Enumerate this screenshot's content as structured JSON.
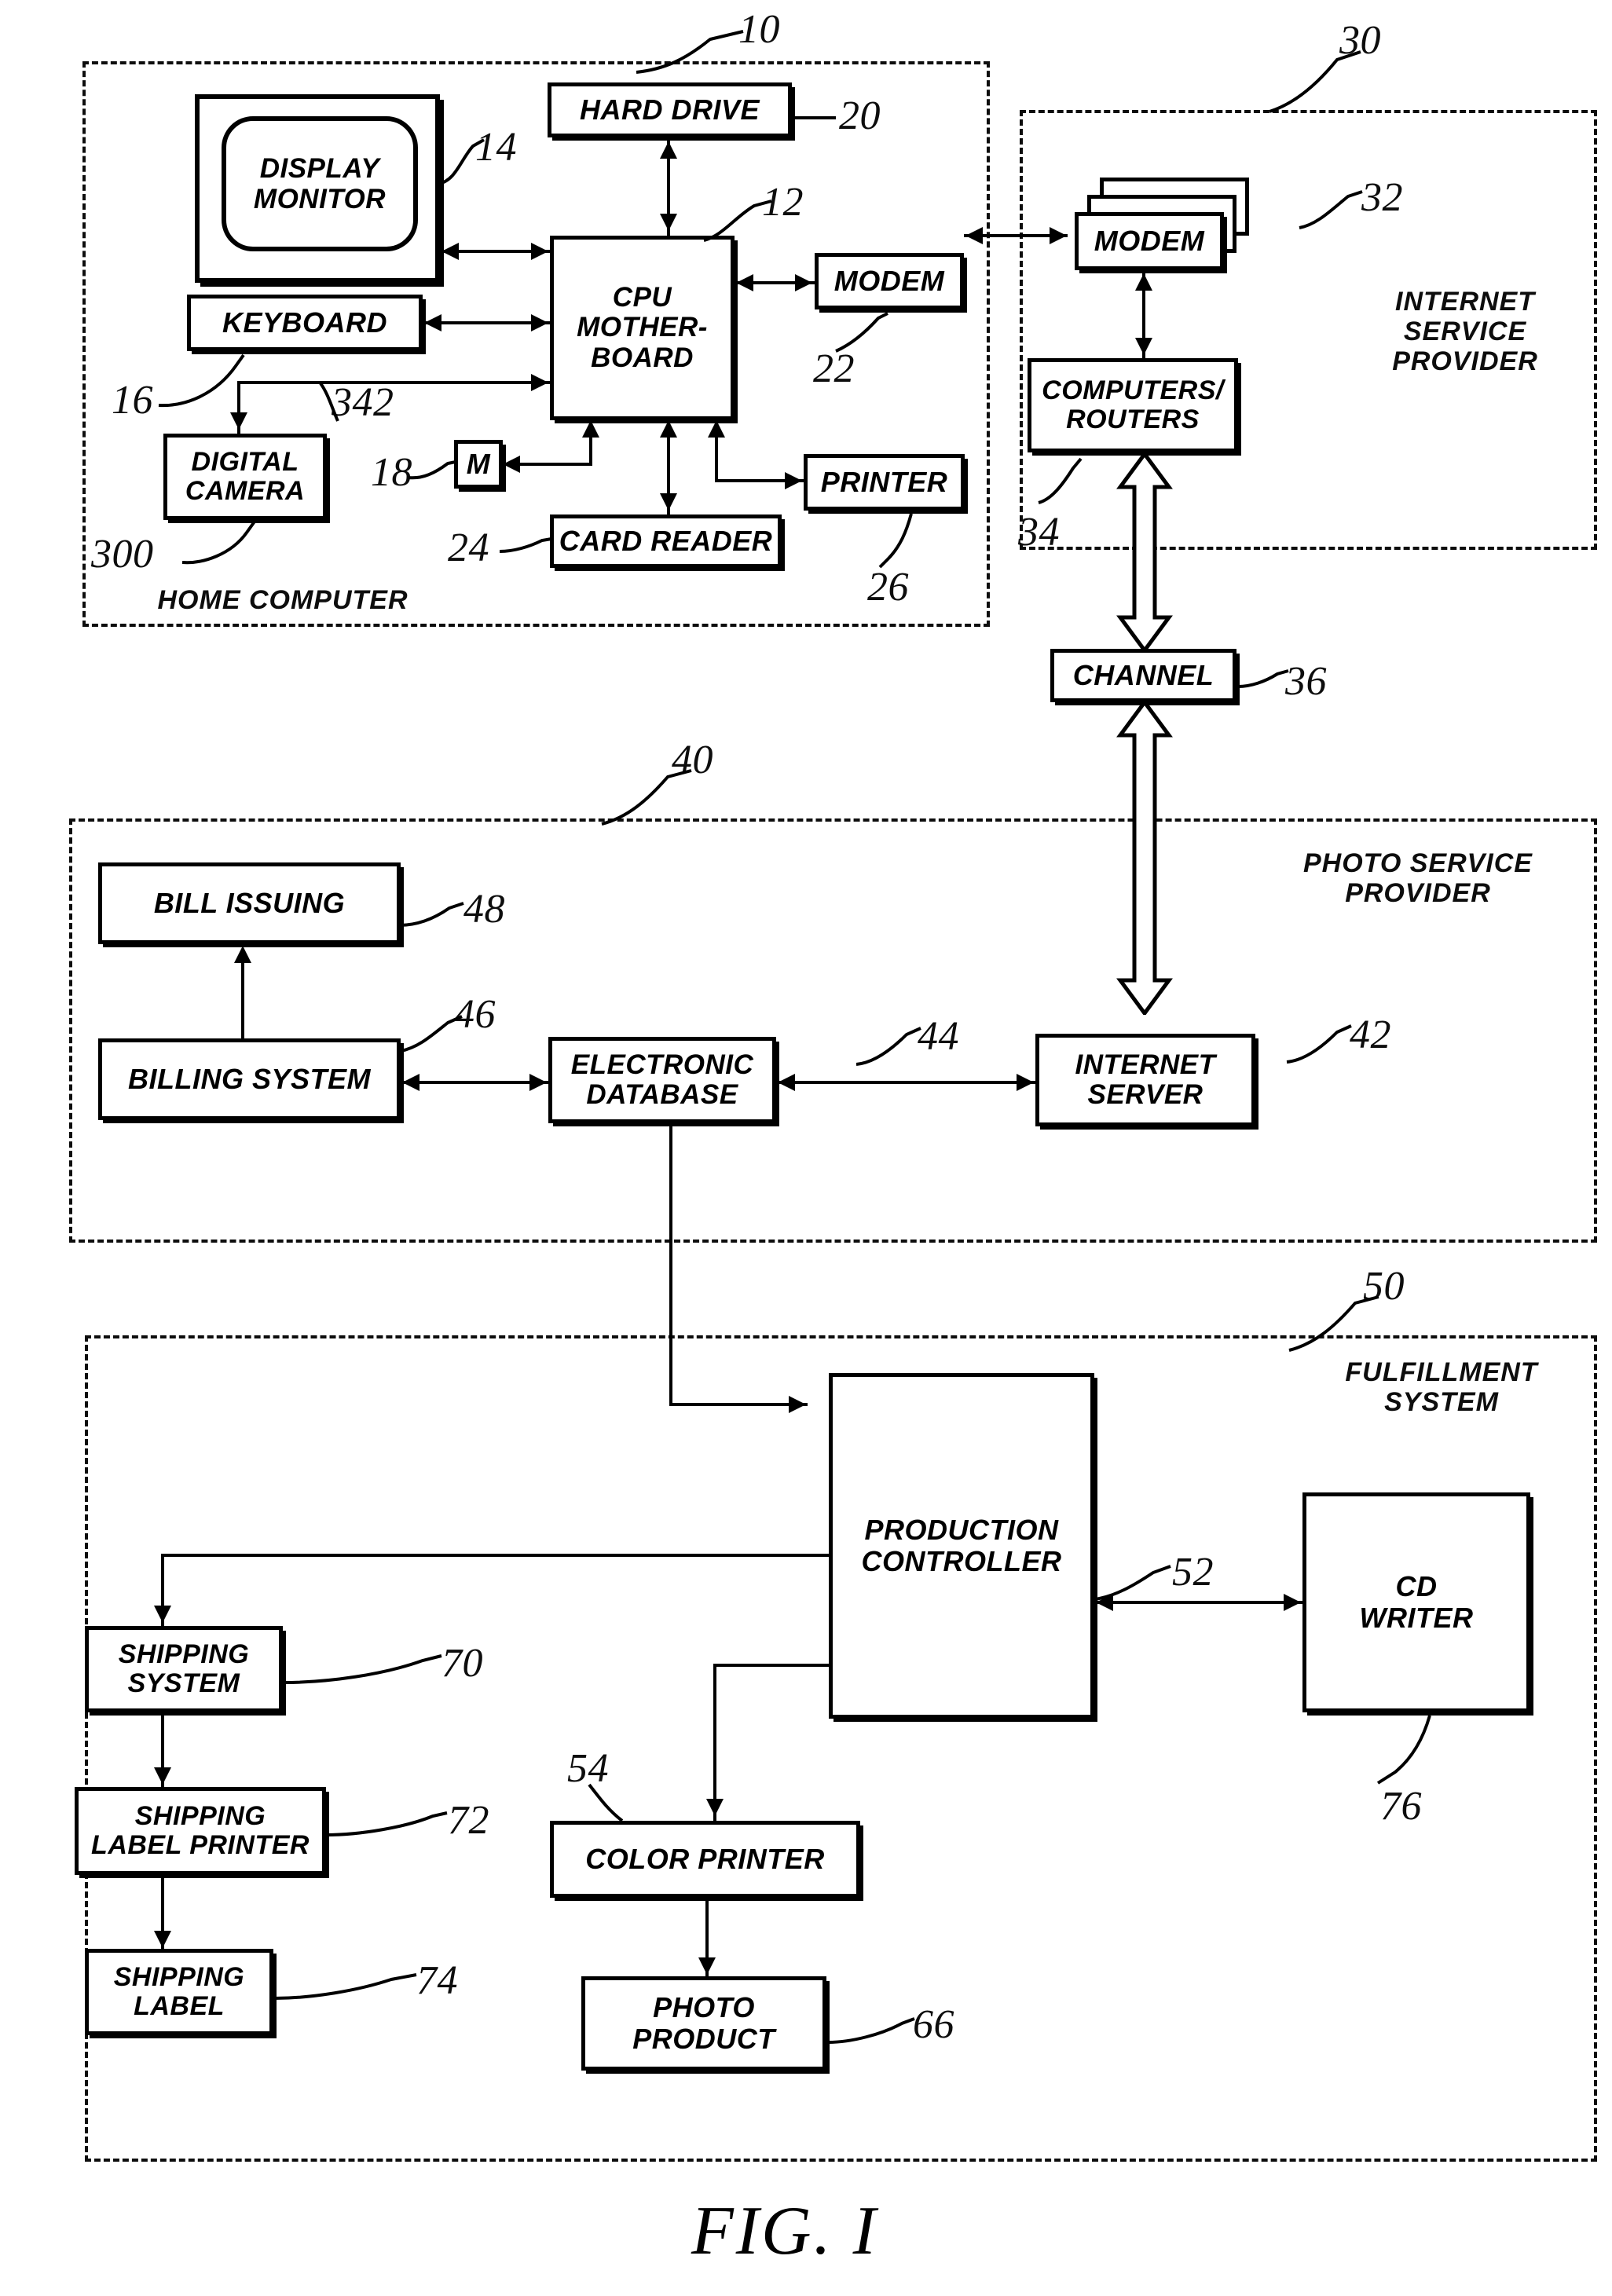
{
  "figure": {
    "caption": "FIG. I"
  },
  "regions": [
    {
      "id": "home-computer",
      "label": "HOME COMPUTER",
      "ref": "10"
    },
    {
      "id": "internet-service-provider",
      "label": "INTERNET\nSERVICE\nPROVIDER",
      "ref": "30"
    },
    {
      "id": "photo-service-provider",
      "label": "PHOTO SERVICE\nPROVIDER",
      "ref": "40"
    },
    {
      "id": "fulfillment-system",
      "label": "FULFILLMENT\nSYSTEM",
      "ref": "50"
    }
  ],
  "blocks": {
    "display_monitor": {
      "label": "DISPLAY\nMONITOR",
      "ref": "14"
    },
    "hard_drive": {
      "label": "HARD DRIVE",
      "ref": "20"
    },
    "cpu_motherboard": {
      "label": "CPU\nMOTHER-\nBOARD",
      "ref": "12"
    },
    "keyboard": {
      "label": "KEYBOARD",
      "ref": "16"
    },
    "digital_camera": {
      "label": "DIGITAL\nCAMERA",
      "ref": "300"
    },
    "camera_link": {
      "ref": "342"
    },
    "mouse": {
      "label": "M",
      "ref": "18"
    },
    "card_reader": {
      "label": "CARD READER",
      "ref": "24"
    },
    "home_modem": {
      "label": "MODEM",
      "ref": "22"
    },
    "home_printer": {
      "label": "PRINTER",
      "ref": "26"
    },
    "isp_modem": {
      "label": "MODEM",
      "ref": "32"
    },
    "computers_routers": {
      "label": "COMPUTERS/\nROUTERS",
      "ref": "34"
    },
    "channel": {
      "label": "CHANNEL",
      "ref": "36"
    },
    "internet_server": {
      "label": "INTERNET\nSERVER",
      "ref": "42"
    },
    "electronic_database": {
      "label": "ELECTRONIC\nDATABASE",
      "ref": "44"
    },
    "billing_system": {
      "label": "BILLING SYSTEM",
      "ref": "46"
    },
    "bill_issuing": {
      "label": "BILL ISSUING",
      "ref": "48"
    },
    "production_controller": {
      "label": "PRODUCTION\nCONTROLLER",
      "ref": "52"
    },
    "color_printer": {
      "label": "COLOR PRINTER",
      "ref": "54"
    },
    "photo_product": {
      "label": "PHOTO\nPRODUCT",
      "ref": "66"
    },
    "shipping_system": {
      "label": "SHIPPING\nSYSTEM",
      "ref": "70"
    },
    "shipping_label_printer": {
      "label": "SHIPPING\nLABEL PRINTER",
      "ref": "72"
    },
    "shipping_label": {
      "label": "SHIPPING\nLABEL",
      "ref": "74"
    },
    "cd_writer": {
      "label": "CD\nWRITER",
      "ref": "76"
    }
  },
  "colors": {
    "ink": "#000000",
    "paper": "#ffffff"
  }
}
